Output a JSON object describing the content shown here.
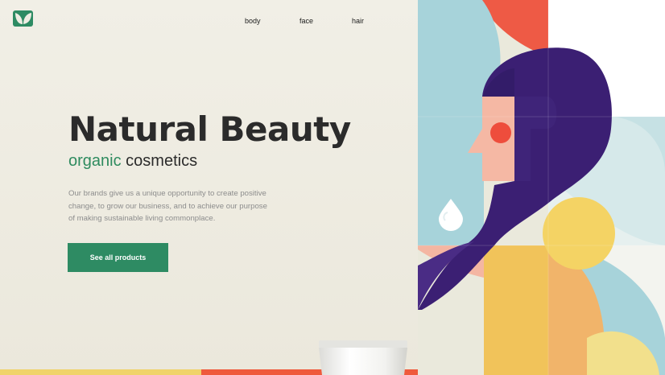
{
  "brand": {
    "logo_icon": "leaf-logo-icon",
    "colors": {
      "primary": "#2e8b63",
      "dark": "#2b2b2b"
    }
  },
  "nav": {
    "items": [
      {
        "label": "body"
      },
      {
        "label": "face"
      },
      {
        "label": "hair"
      }
    ]
  },
  "hero": {
    "title": "Natural Beauty",
    "subtitle_accent": "organic",
    "subtitle_rest": " cosmetics",
    "description": "Our brands give us a unique opportunity to create positive change, to grow our business, and to achieve our purpose of making sustainable living commonplace.",
    "cta_label": "See all products"
  },
  "illustration": {
    "icon": "woman-portrait-illustration",
    "product_icon": "cosmetic-tube-icon"
  }
}
